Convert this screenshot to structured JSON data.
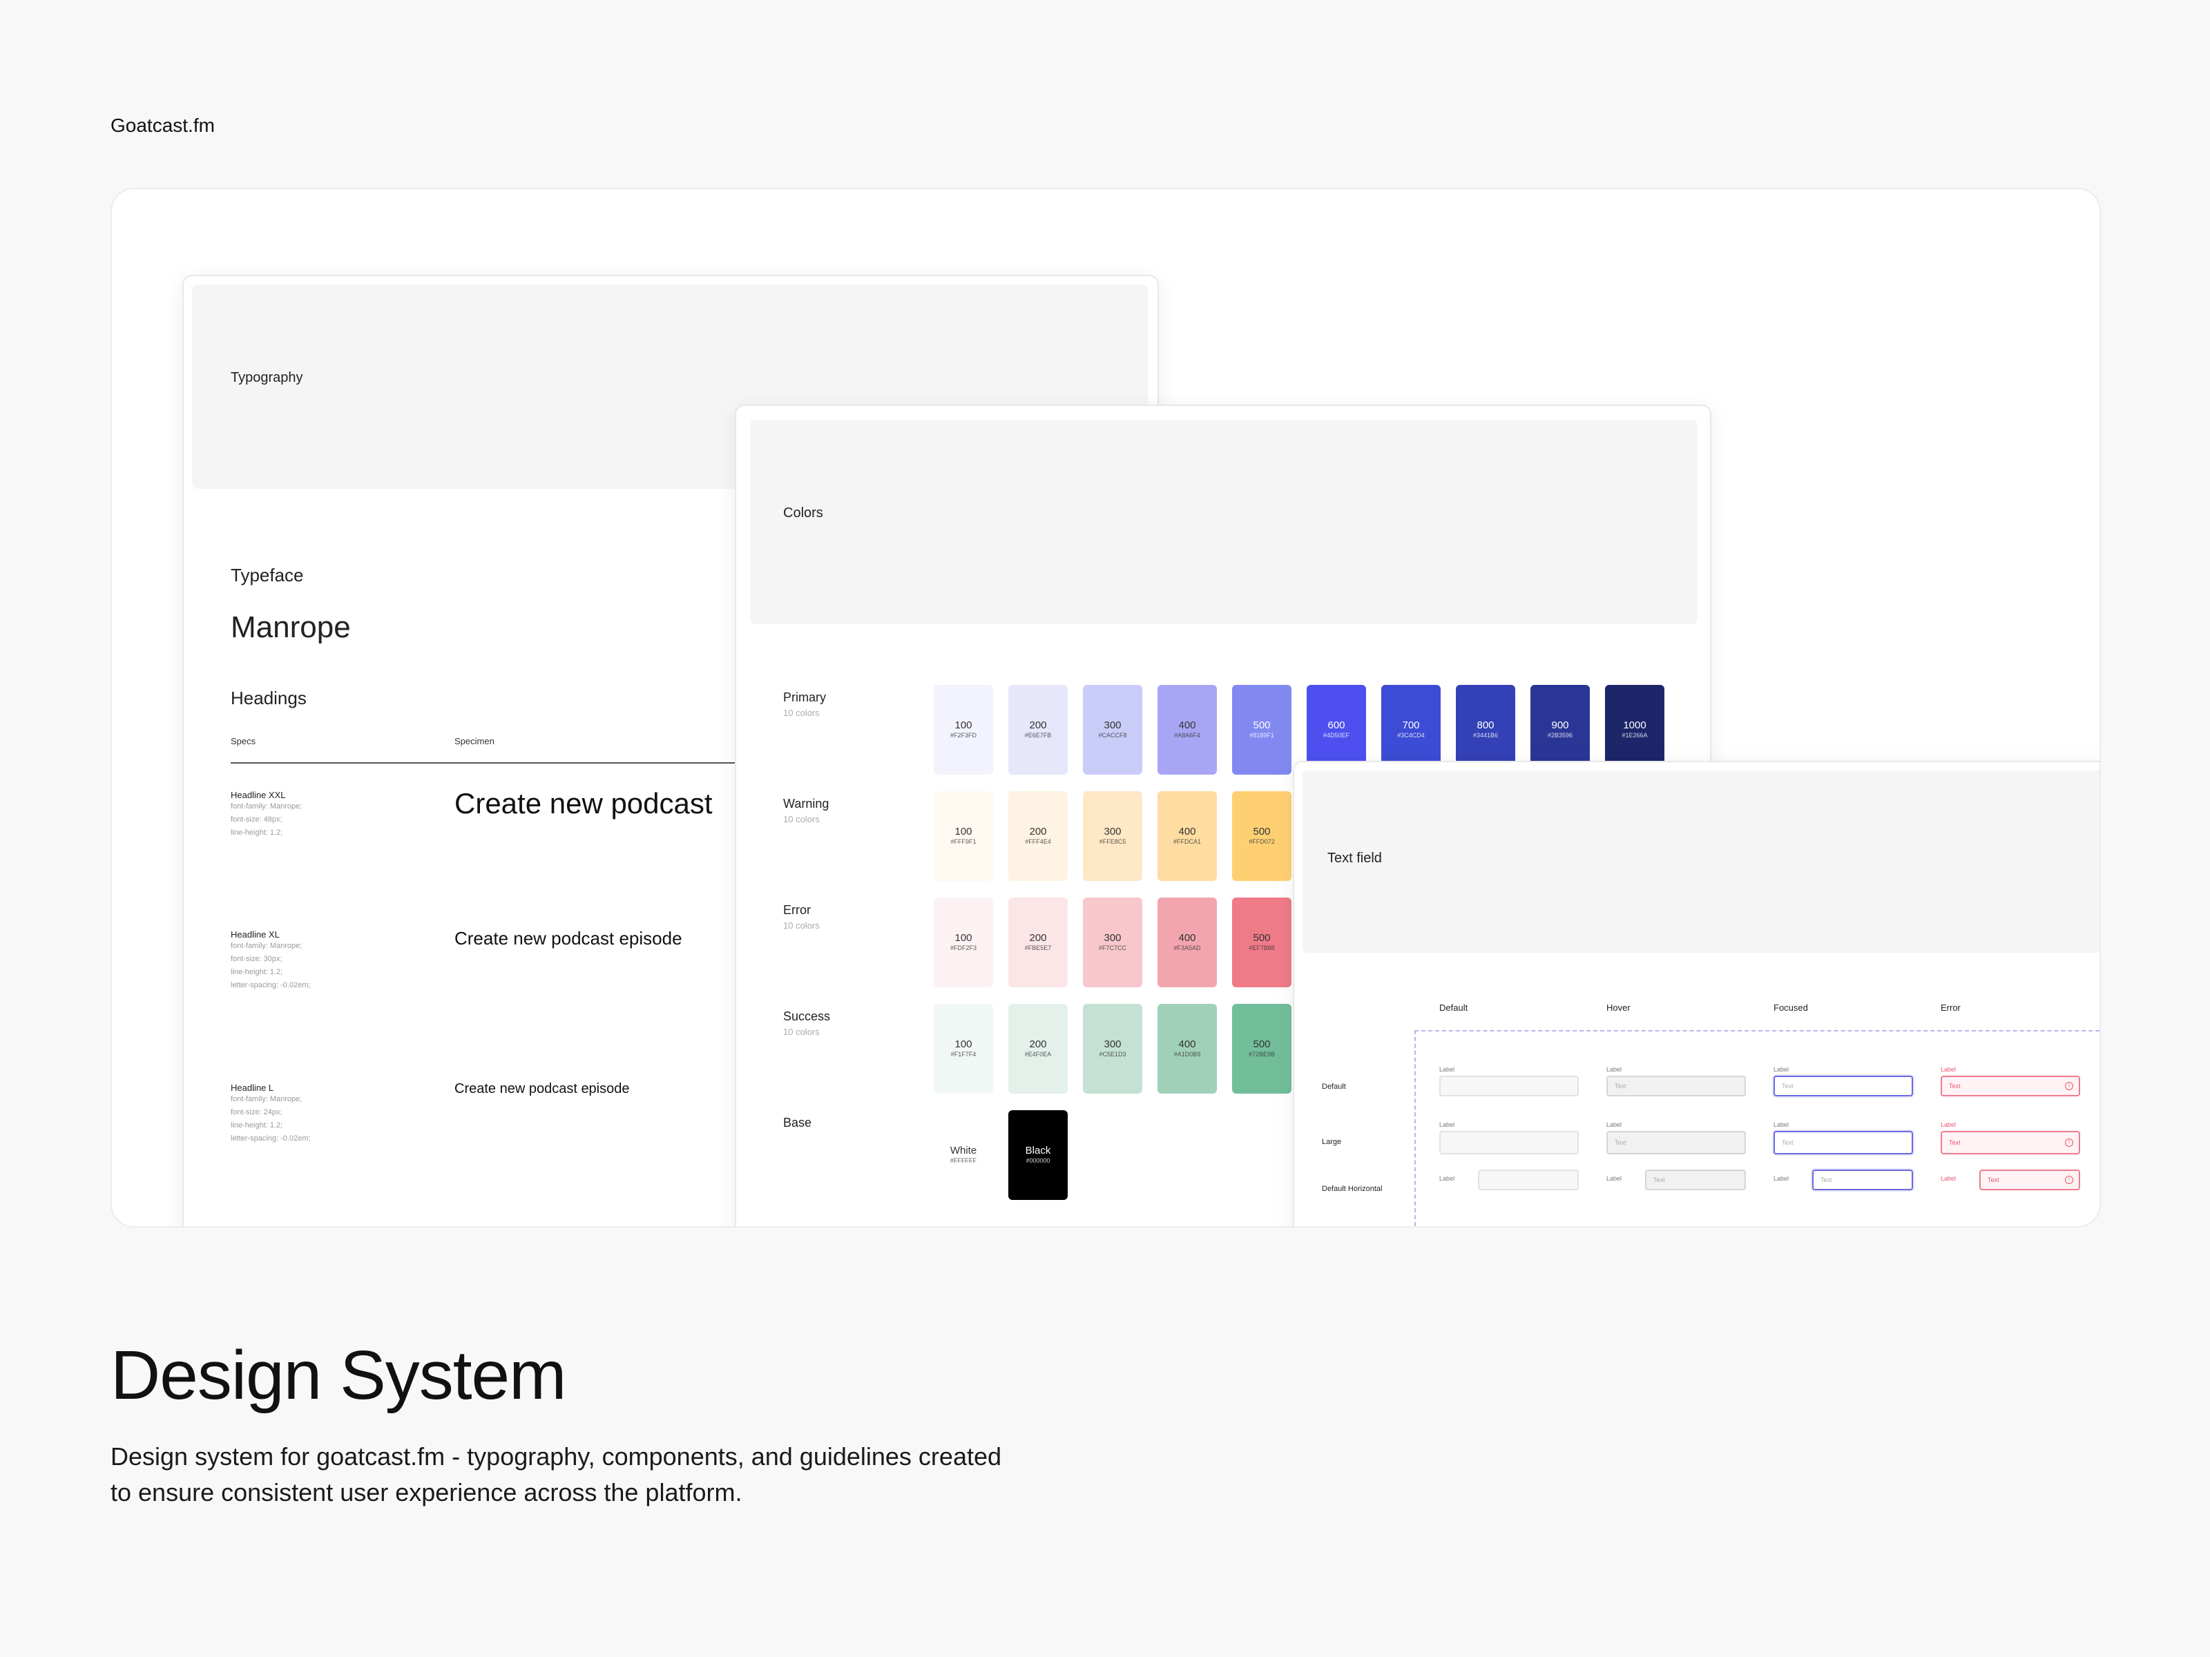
{
  "brand": "Goatcast.fm",
  "hero": {
    "title": "Design System",
    "description": "Design system for goatcast.fm - typography, components, and guidelines created to ensure consistent user experience across the platform."
  },
  "typography": {
    "header": "Typography",
    "typeface_label": "Typeface",
    "typeface": "Manrope",
    "headings_label": "Headings",
    "col_specs": "Specs",
    "col_specimen": "Specimen",
    "rows": [
      {
        "name": "Headline XXL",
        "specs": [
          "font-family: Manrope;",
          "font-size: 48px;",
          "line-height: 1.2;"
        ],
        "specimen": "Create new podcast"
      },
      {
        "name": "Headline XL",
        "specs": [
          "font-family: Manrope;",
          "font-size: 30px;",
          "line-height: 1.2;",
          "letter-spacing: -0.02em;"
        ],
        "specimen": "Create new podcast episode"
      },
      {
        "name": "Headline L",
        "specs": [
          "font-family: Manrope;",
          "font-size: 24px;",
          "line-height: 1.2;",
          "letter-spacing: -0.02em;"
        ],
        "specimen": "Create new podcast episode"
      }
    ]
  },
  "colors": {
    "header": "Colors",
    "groups": [
      {
        "name": "Primary",
        "sub": "10 colors",
        "swatches": [
          {
            "step": "100",
            "hex": "#F2F3FD",
            "text": "#333"
          },
          {
            "step": "200",
            "hex": "#E6E7FB",
            "text": "#333"
          },
          {
            "step": "300",
            "hex": "#CACCF8",
            "text": "#333"
          },
          {
            "step": "400",
            "hex": "#A8A6F4",
            "text": "#333"
          },
          {
            "step": "500",
            "hex": "#8189F1",
            "text": "#fff"
          },
          {
            "step": "600",
            "hex": "#4D50EF",
            "text": "#fff"
          },
          {
            "step": "700",
            "hex": "#3C4CD4",
            "text": "#fff"
          },
          {
            "step": "800",
            "hex": "#3441B6",
            "text": "#fff"
          },
          {
            "step": "900",
            "hex": "#2B3596",
            "text": "#fff"
          },
          {
            "step": "1000",
            "hex": "#1E266A",
            "text": "#fff"
          }
        ]
      },
      {
        "name": "Warning",
        "sub": "10 colors",
        "swatches": [
          {
            "step": "100",
            "hex": "#FFF9F1",
            "text": "#333"
          },
          {
            "step": "200",
            "hex": "#FFF4E4",
            "text": "#333"
          },
          {
            "step": "300",
            "hex": "#FFE8C5",
            "text": "#333"
          },
          {
            "step": "400",
            "hex": "#FFDCA1",
            "text": "#333"
          },
          {
            "step": "500",
            "hex": "#FFD072",
            "text": "#333"
          }
        ]
      },
      {
        "name": "Error",
        "sub": "10 colors",
        "swatches": [
          {
            "step": "100",
            "hex": "#FDF2F3",
            "text": "#333"
          },
          {
            "step": "200",
            "hex": "#FBE5E7",
            "text": "#333"
          },
          {
            "step": "300",
            "hex": "#F7C7CC",
            "text": "#333"
          },
          {
            "step": "400",
            "hex": "#F3A5AD",
            "text": "#333"
          },
          {
            "step": "500",
            "hex": "#EF7B88",
            "text": "#333"
          }
        ]
      },
      {
        "name": "Success",
        "sub": "10 colors",
        "swatches": [
          {
            "step": "100",
            "hex": "#F1F7F4",
            "text": "#333"
          },
          {
            "step": "200",
            "hex": "#E4F0EA",
            "text": "#333"
          },
          {
            "step": "300",
            "hex": "#C5E1D3",
            "text": "#333"
          },
          {
            "step": "400",
            "hex": "#A1D0B9",
            "text": "#333"
          },
          {
            "step": "500",
            "hex": "#72BE9B",
            "text": "#333"
          }
        ]
      },
      {
        "name": "Base",
        "sub": "",
        "swatches": [
          {
            "step": "White",
            "hex": "#FFFFFF",
            "text": "#333"
          },
          {
            "step": "Black",
            "hex": "#000000",
            "text": "#fff"
          }
        ]
      }
    ]
  },
  "textfield": {
    "header": "Text field",
    "columns": [
      "Default",
      "Hover",
      "Focused",
      "Error"
    ],
    "rows": [
      "Default",
      "Large",
      "Default Horizontal"
    ],
    "label": "Label",
    "placeholder": "Text"
  }
}
